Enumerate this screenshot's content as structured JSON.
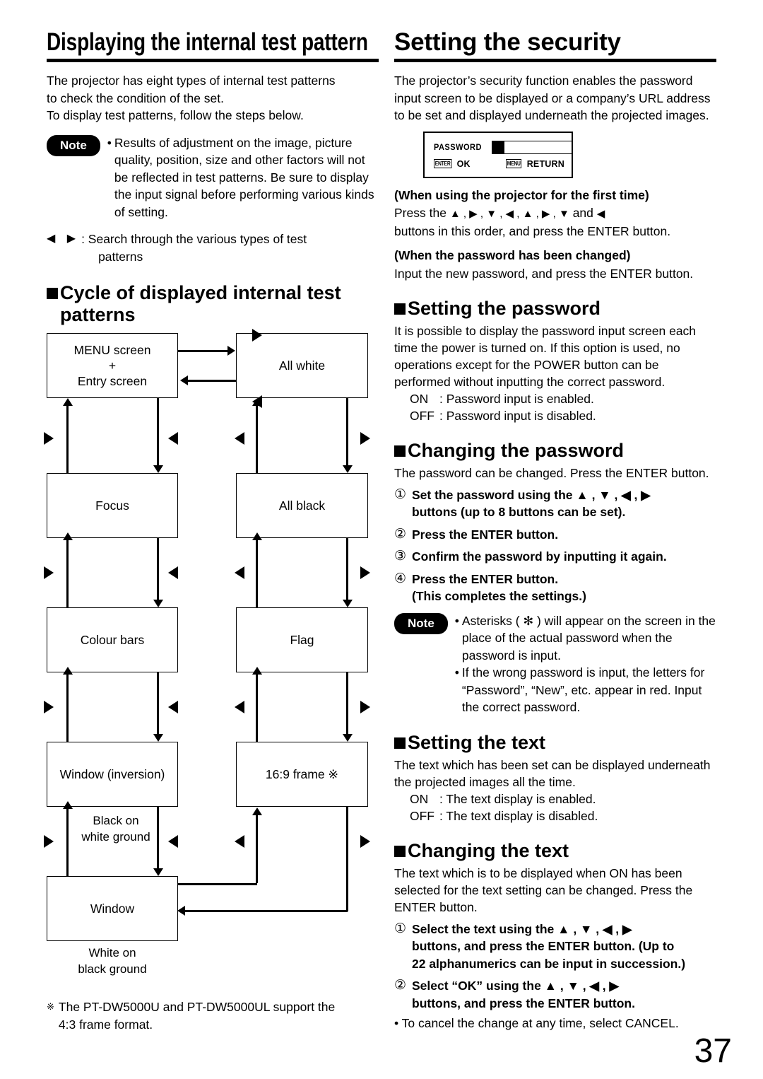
{
  "page_number": "37",
  "left_column": {
    "title": "Displaying the internal test pattern",
    "intro": {
      "line1": "The projector has eight types of internal test patterns",
      "line2": "to check the condition of the set.",
      "line3": "To display test patterns, follow the steps below."
    },
    "note": {
      "label": "Note",
      "bullet": "•",
      "text": "Results of adjustment on the image, picture quality, position, size and other factors will not be reflected in test patterns. Be sure to display the input signal before performing various kinds of setting."
    },
    "search_line": {
      "glyphs": "◀ ▶",
      "text": ": Search through the various types of test",
      "text2": "patterns"
    },
    "section_heading": "Cycle of displayed internal test patterns",
    "flow": {
      "boxes": {
        "menu_entry_line1": "MENU screen",
        "menu_entry_line2": "+",
        "menu_entry_line3": "Entry screen",
        "all_white": "All white",
        "focus": "Focus",
        "all_black": "All black",
        "colour_bars": "Colour bars",
        "flag": "Flag",
        "window_inversion": "Window (inversion)",
        "frame_16_9": "16:9 frame ※",
        "window": "Window"
      },
      "captions": {
        "black_on_white_1": "Black on",
        "black_on_white_2": "white ground",
        "white_on_black_1": "White on",
        "white_on_black_2": "black ground"
      }
    },
    "footnote": {
      "mark": "※",
      "line1": "The PT-DW5000U and PT-DW5000UL support the",
      "line2": "4:3 frame format."
    }
  },
  "right_column": {
    "title": "Setting the security",
    "intro": "The projector’s security function enables the password input screen to be displayed or a company’s URL address to be set and displayed underneath the projected images.",
    "osd": {
      "password_label": "PASSWORD",
      "enter_key": "ENTER",
      "enter_action": "OK",
      "menu_key": "MENU",
      "menu_action": "RETURN"
    },
    "first_time": {
      "heading": "(When using the projector for the first time)",
      "line1_prefix": "Press the",
      "sequence": "▲ , ▶ , ▼ , ◀ , ▲ , ▶ , ▼",
      "line1_middle": "and",
      "last_glyph": "◀",
      "line2": "buttons in this order, and press the ENTER button."
    },
    "changed": {
      "heading": "(When the password has been changed)",
      "line1": "Input the new password, and press the ENTER button."
    },
    "setting_password": {
      "heading": "Setting the password",
      "body": "It is possible to display the password input screen each time the power is turned on. If this option is used, no operations except for the POWER button can be performed without inputting the correct password.",
      "on_key": "ON",
      "on_value": ": Password input is enabled.",
      "off_key": "OFF",
      "off_value": ": Password input is disabled."
    },
    "changing_password": {
      "heading": "Changing the password",
      "body": "The password can be changed. Press the ENTER button.",
      "steps": [
        {
          "num": "①",
          "line1": "Set the password using the ▲ , ▼ , ◀ , ▶",
          "line2": "buttons (up to 8 buttons can be set)."
        },
        {
          "num": "②",
          "line1": "Press the ENTER button.",
          "line2": ""
        },
        {
          "num": "③",
          "line1": "Confirm the password by inputting it again.",
          "line2": ""
        },
        {
          "num": "④",
          "line1": "Press the ENTER button.",
          "line2": "(This completes the settings.)"
        }
      ],
      "note": {
        "label": "Note",
        "bullet1": "Asterisks ( ✻ ) will appear on the screen in the place of the actual password when the password is input.",
        "bullet2": "If the wrong password is input, the letters for “Password”, “New”, etc. appear in red. Input the correct password."
      }
    },
    "setting_text": {
      "heading": "Setting the text",
      "body": "The text which has been set can be displayed underneath the projected images all the time.",
      "on_key": "ON",
      "on_value": ": The text display is enabled.",
      "off_key": "OFF",
      "off_value": ": The text display is disabled."
    },
    "changing_text": {
      "heading": "Changing the text",
      "body": "The text which is to be displayed when ON has been selected for the text setting can be changed. Press the ENTER button.",
      "steps": [
        {
          "num": "①",
          "line1": "Select the text using the ▲ , ▼ , ◀ , ▶",
          "line2": "buttons, and press the ENTER button. (Up to",
          "line3": "22 alphanumerics can be input in succession.)"
        },
        {
          "num": "②",
          "line1": "Select “OK” using the ▲ , ▼ , ◀ , ▶",
          "line2": "buttons, and press the ENTER button.",
          "line3": ""
        }
      ],
      "cancel_note": "• To cancel the change at any time, select CANCEL."
    }
  }
}
